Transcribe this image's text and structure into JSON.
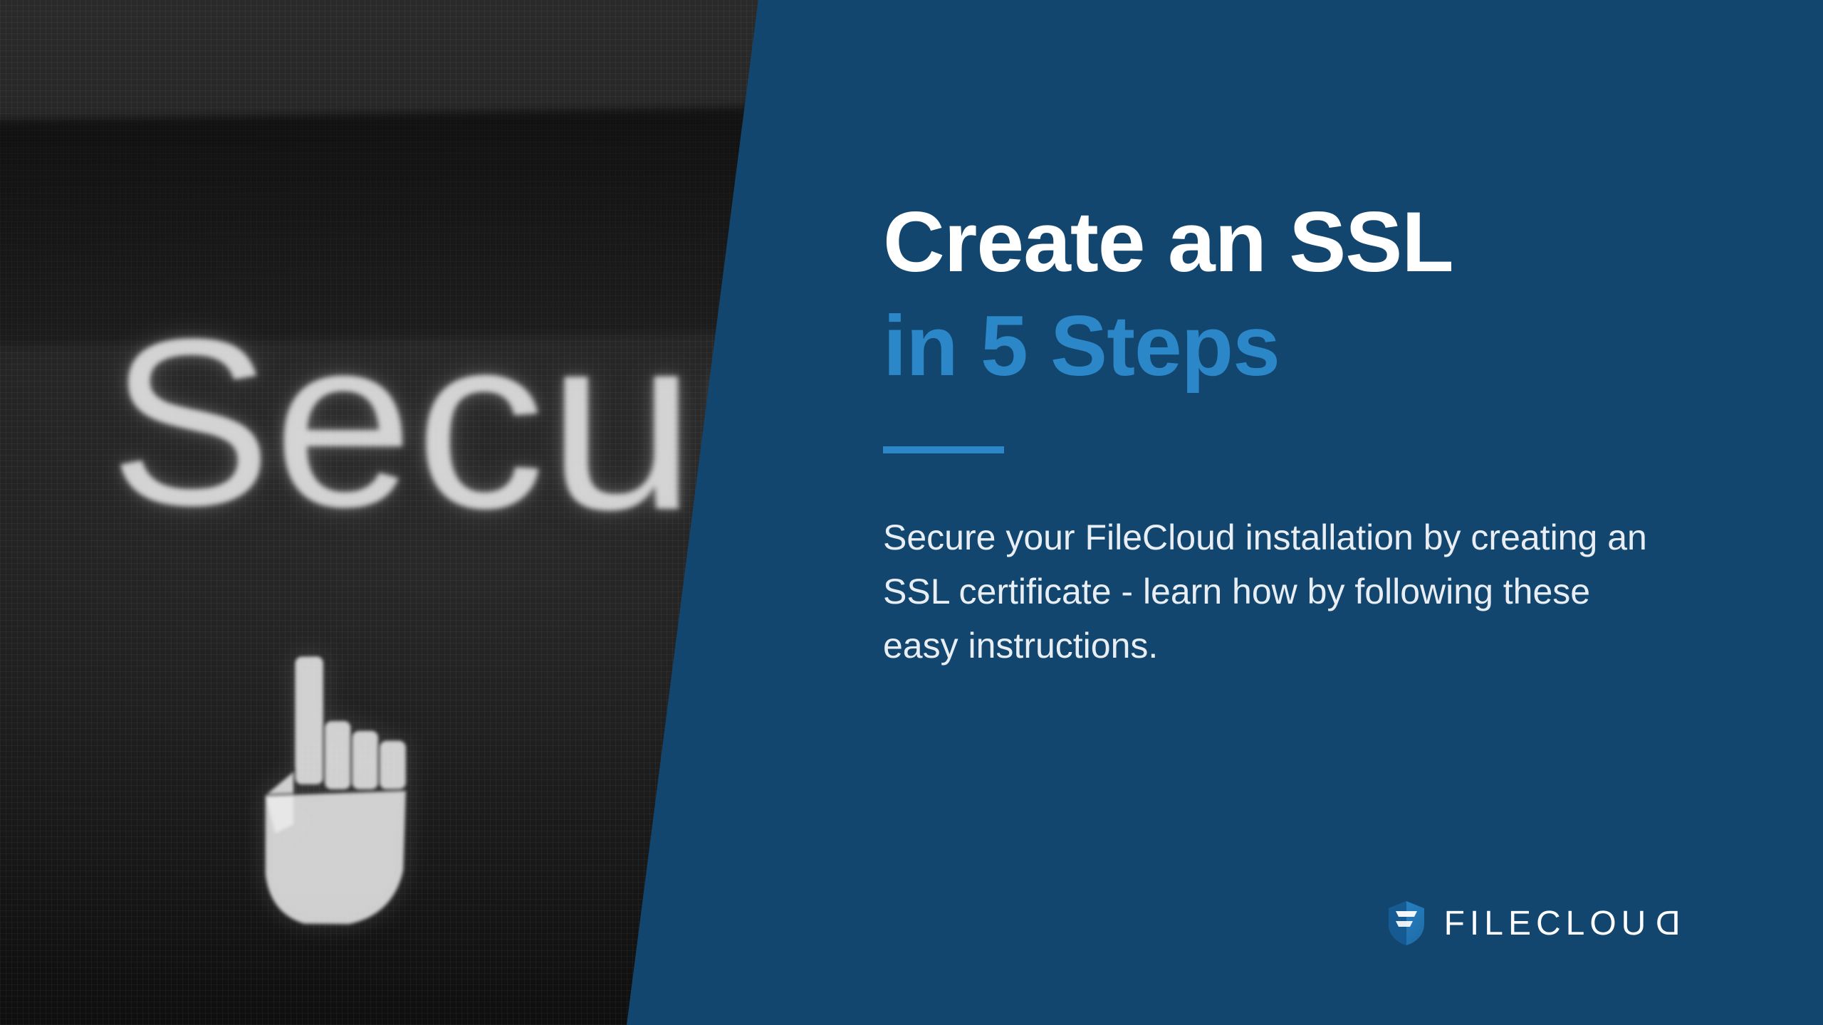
{
  "hero": {
    "title_line1": "Create an SSL",
    "title_line2": "in 5 Steps",
    "subtitle": "Secure your FileCloud installation by creating an SSL certificate - learn how by following these easy instructions."
  },
  "background_image": {
    "visible_word_fragment": "Securit",
    "cursor_icon": "hand-pointer-cursor"
  },
  "brand": {
    "name_part1": "FILECLOU",
    "name_part2_mirrored": "D",
    "full_name": "FILECLOUD"
  },
  "colors": {
    "panel_bg": "#12466e",
    "accent_blue": "#2b87c8",
    "white": "#ffffff",
    "body_text": "#e8eef3",
    "image_bg_dark": "#1a1a1a"
  }
}
